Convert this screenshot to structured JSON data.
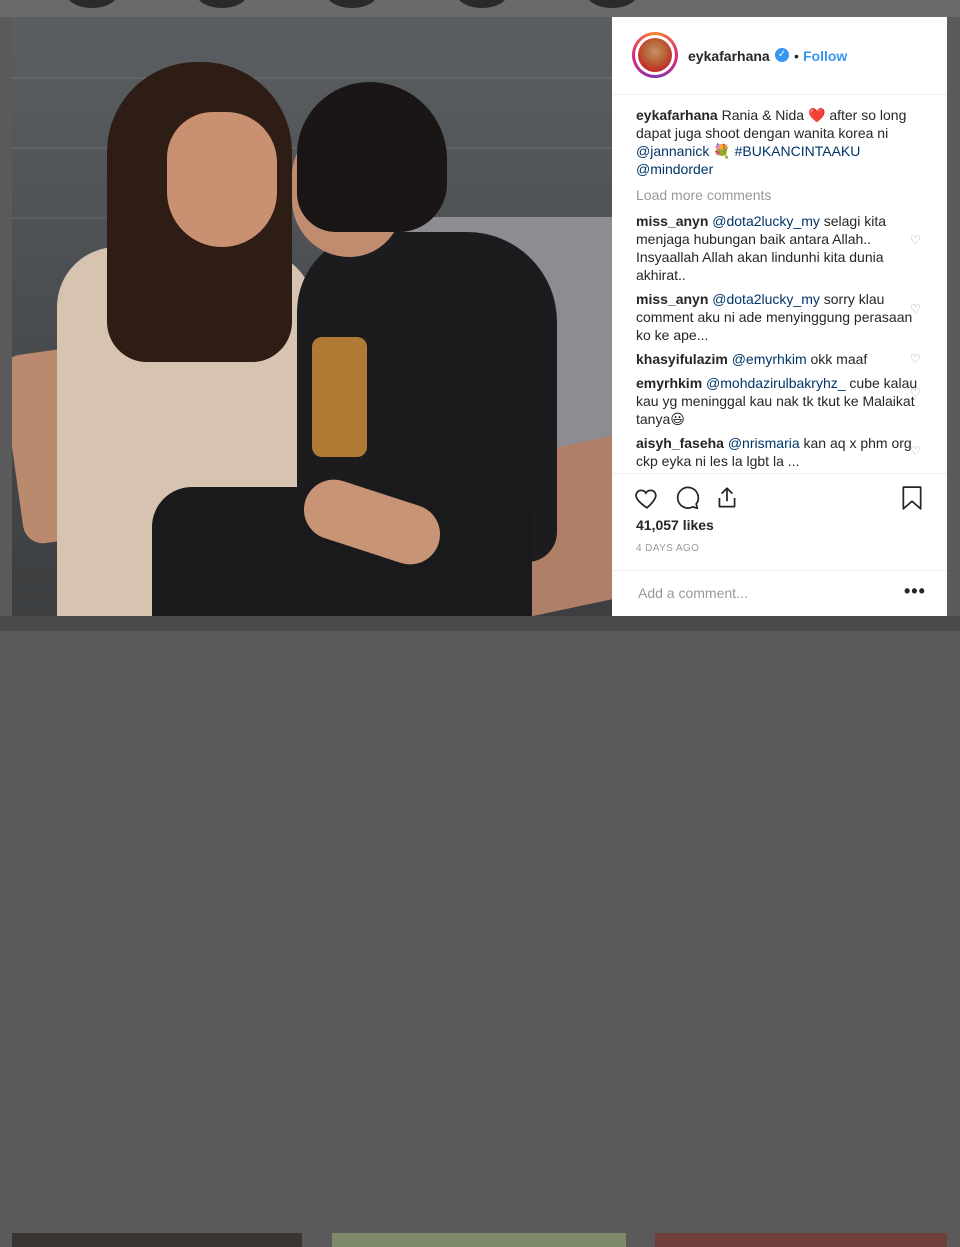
{
  "post": {
    "username": "eykafarhana",
    "follow_label": "Follow",
    "bullet": "•",
    "verified_mark": "✓",
    "caption": {
      "user": "eykafarhana",
      "text1": " Rania & Nida ",
      "heart": "❤️",
      "text2": " after so long dapat juga shoot dengan wanita korea ni ",
      "mention1": "@jannanick",
      "emoji": "💐",
      "hashtag": "#BUKANCINTAAKU",
      "mention2": "@mindorder"
    },
    "load_more": "Load more comments",
    "comments": [
      {
        "user": "miss_anyn",
        "mention": "@dota2lucky_my",
        "text": " selagi kita menjaga hubungan baik antara Allah.. Insyaallah Allah akan lindunhi kita dunia akhirat.."
      },
      {
        "user": "miss_anyn",
        "mention": "@dota2lucky_my",
        "text": " sorry klau comment aku ni ade menyinggung perasaan ko ke ape..."
      },
      {
        "user": "khasyifulazim",
        "mention": "@emyrhkim",
        "text": " okk maaf"
      },
      {
        "user": "emyrhkim",
        "mention": "@mohdazirulbakryhz_",
        "text": " cube kalau kau yg meninggal kau nak tk tkut ke Malaikat tanya😃"
      },
      {
        "user": "aisyh_faseha",
        "mention": "@nrismaria",
        "text": " kan aq x phm org ckp eyka ni les la lgbt la ..."
      }
    ],
    "likes": "41,057 likes",
    "time": "4 DAYS AGO",
    "add_comment_placeholder": "Add a comment...",
    "more_label": "•••"
  },
  "icons": {
    "like": "heart-icon",
    "comment": "comment-bubble-icon",
    "share": "share-icon",
    "save": "bookmark-icon",
    "comment_like": "heart-icon"
  },
  "colors": {
    "link": "#3897f0",
    "mention": "#003569",
    "muted": "#999999",
    "text": "#262626"
  }
}
